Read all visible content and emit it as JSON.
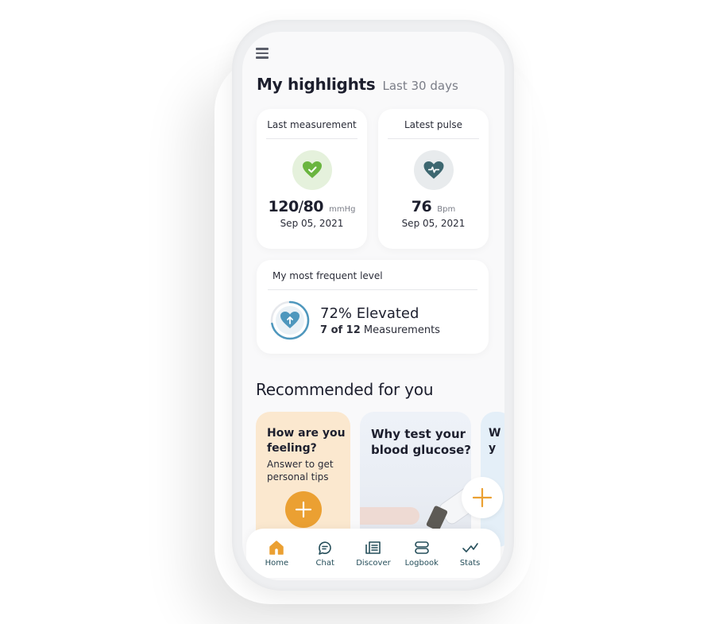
{
  "header": {
    "title": "My highlights",
    "subtitle": "Last 30 days"
  },
  "last_measurement": {
    "label": "Last measurement",
    "systolic": "120",
    "separator": "/",
    "diastolic": "80",
    "unit": "mmHg",
    "date": "Sep 05, 2021",
    "icon": "heart-check-icon",
    "status_color": "#6ab53f"
  },
  "latest_pulse": {
    "label": "Latest pulse",
    "value": "76",
    "unit": "Bpm",
    "date": "Sep 05, 2021",
    "icon": "heart-pulse-icon",
    "color": "#3d6770"
  },
  "frequent_level": {
    "label": "My most frequent level",
    "percent_text": "72% Elevated",
    "percent": 72,
    "count": "7 of 12",
    "count_suffix": "Measurements",
    "icon": "heart-arrow-up-icon",
    "color": "#4e97bd"
  },
  "recommended": {
    "title": "Recommended for you",
    "cards": [
      {
        "heading": "How are you feeling?",
        "description": "Answer to get personal tips",
        "action": "plus-icon"
      },
      {
        "heading": "Why test your blood glucose?"
      },
      {
        "heading": "W y"
      }
    ]
  },
  "accent_color": "#eba032",
  "nav": {
    "items": [
      {
        "label": "Home",
        "icon": "home-icon",
        "active": true
      },
      {
        "label": "Chat",
        "icon": "chat-icon"
      },
      {
        "label": "Discover",
        "icon": "discover-icon"
      },
      {
        "label": "Logbook",
        "icon": "logbook-icon"
      },
      {
        "label": "Stats",
        "icon": "stats-icon"
      }
    ]
  }
}
